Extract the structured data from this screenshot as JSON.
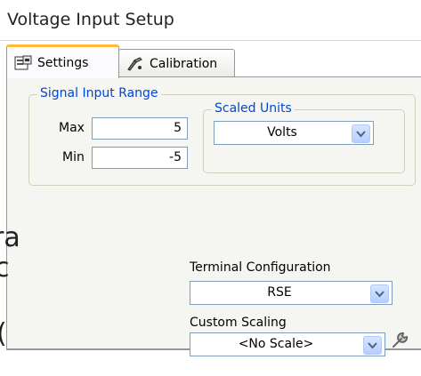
{
  "window": {
    "title": "Voltage Input Setup"
  },
  "tabs": [
    {
      "label": "Settings",
      "icon": "settings-icon",
      "active": true
    },
    {
      "label": "Calibration",
      "icon": "calibration-icon",
      "active": false
    }
  ],
  "signal_input_range": {
    "legend": "Signal Input Range",
    "max_label": "Max",
    "max_value": "5",
    "min_label": "Min",
    "min_value": "-5"
  },
  "scaled_units": {
    "legend": "Scaled Units",
    "value": "Volts"
  },
  "terminal_configuration": {
    "label": "Terminal Configuration",
    "value": "RSE"
  },
  "custom_scaling": {
    "label": "Custom Scaling",
    "value": "<No Scale>"
  },
  "left_clipped_text": [
    "ra",
    "c",
    "("
  ],
  "colors": {
    "accent": "#0046d5",
    "tab_highlight": "#ffb93b",
    "panel": "#f5f5f1"
  }
}
